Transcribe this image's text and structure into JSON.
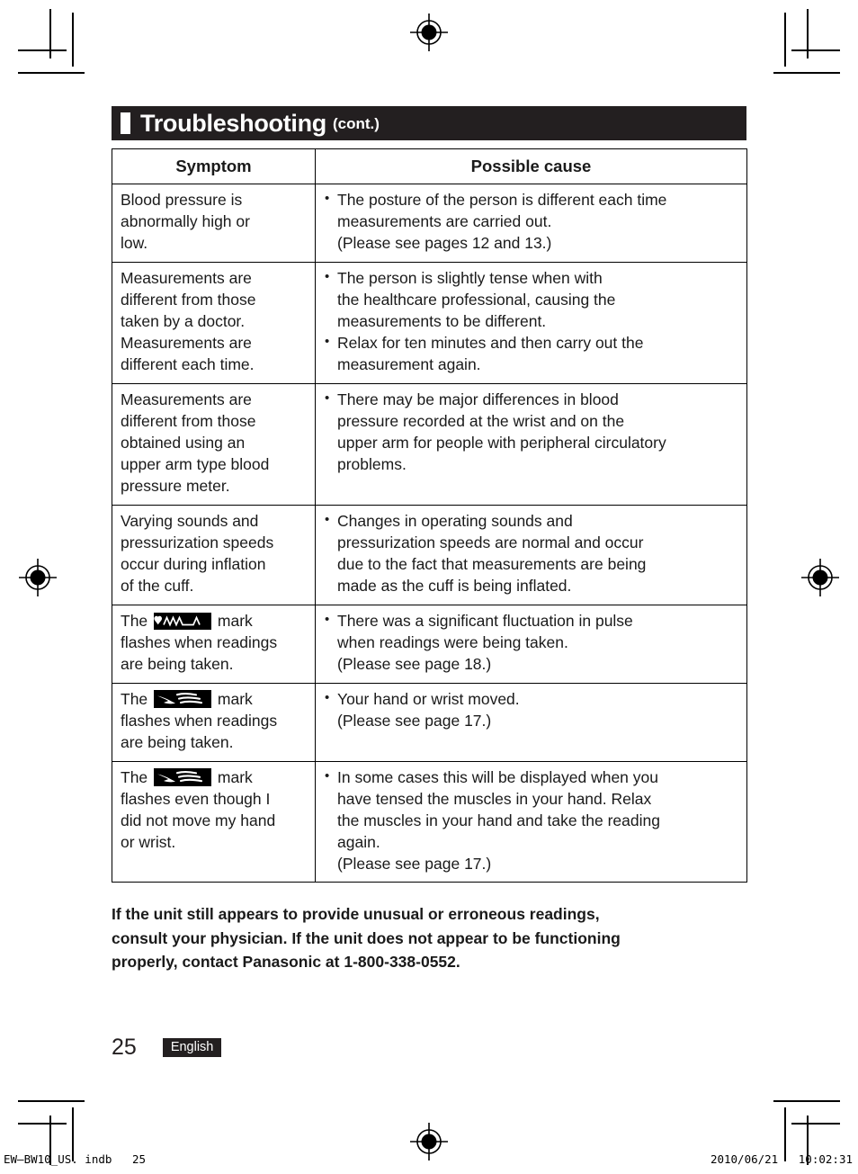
{
  "document": {
    "title": "Troubleshooting",
    "title_suffix": "(cont.)"
  },
  "table": {
    "headers": {
      "symptom": "Symptom",
      "cause": "Possible cause"
    },
    "rows": [
      {
        "symptom_lines": [
          "Blood pressure is",
          "abnormally high or",
          "low."
        ],
        "causes": [
          [
            "The posture of the person is different each time",
            "measurements are carried out.",
            "(Please see pages 12 and 13.)"
          ]
        ]
      },
      {
        "symptom_lines": [
          "Measurements are",
          "different from those",
          "taken by a doctor.",
          "Measurements are",
          "different each time."
        ],
        "causes": [
          [
            "The person is slightly tense when with",
            "the healthcare professional, causing the",
            "measurements to be different."
          ],
          [
            "Relax for ten minutes and then carry out the",
            "measurement again."
          ]
        ]
      },
      {
        "symptom_lines": [
          "Measurements are",
          "different from those",
          "obtained using an",
          "upper arm type blood",
          "pressure meter."
        ],
        "causes": [
          [
            "There may be major differences in blood",
            "pressure recorded at the wrist and on the",
            "upper arm for people with peripheral circulatory",
            "problems."
          ]
        ]
      },
      {
        "symptom_lines": [
          "Varying sounds and",
          "pressurization speeds",
          "occur during inflation",
          "of the cuff."
        ],
        "causes": [
          [
            "Changes in operating sounds and",
            "pressurization speeds are normal and occur",
            "due to the fact that measurements are being",
            "made as the cuff is being inflated."
          ]
        ]
      },
      {
        "symptom_prefix": "The",
        "symptom_icon": "heart-pulse-mark-icon",
        "symptom_suffix": "mark",
        "symptom_lines": [
          "flashes when readings",
          "are being taken."
        ],
        "causes": [
          [
            "There was a significant fluctuation in pulse",
            "when readings were being taken.",
            "(Please see page 18.)"
          ]
        ]
      },
      {
        "symptom_prefix": "The",
        "symptom_icon": "body-movement-mark-icon",
        "symptom_suffix": "mark",
        "symptom_lines": [
          "flashes when readings",
          "are being taken."
        ],
        "causes": [
          [
            "Your hand or wrist moved.",
            "(Please see page 17.)"
          ]
        ]
      },
      {
        "symptom_prefix": "The",
        "symptom_icon": "body-movement-mark-icon",
        "symptom_suffix": "mark",
        "symptom_lines": [
          "flashes even though I",
          "did not move my hand",
          "or wrist."
        ],
        "causes": [
          [
            "In some cases this will be displayed when you",
            "have tensed the muscles in your hand. Relax",
            "the muscles in your hand and take the reading",
            "again.",
            "(Please see page 17.)"
          ]
        ]
      }
    ]
  },
  "notice": {
    "lines": [
      "If the unit still appears to provide unusual or erroneous readings,",
      "consult your physician. If the unit does not appear to be functioning",
      "properly, contact Panasonic at 1-800-338-0552."
    ]
  },
  "footer": {
    "page_number": "25",
    "language": "English"
  },
  "print_footer": {
    "left": "EW–BW10_US. indb   25",
    "right": "2010/06/21   10:02:31"
  },
  "colors": {
    "ink": "#231f20",
    "paper": "#ffffff"
  }
}
